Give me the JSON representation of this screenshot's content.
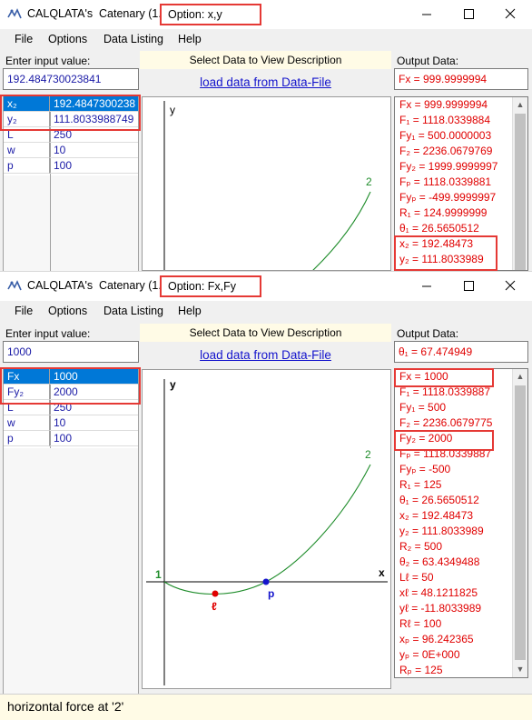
{
  "app_title": "CALQLATA's  Catenary (1.2",
  "menu": [
    "File",
    "Options",
    "Data Listing",
    "Help"
  ],
  "labels": {
    "enter_input": "Enter input value:",
    "select_desc": "Select Data to View Description",
    "load_data": "load data from Data-File",
    "output_data": "Output Data:"
  },
  "window1": {
    "option": "Option: x,y",
    "input_value": "192.484730023841",
    "output_value": "Fx = 999.9999994",
    "grid": [
      {
        "k": "x₂",
        "v": "192.4847300238",
        "selected": true
      },
      {
        "k": "y₂",
        "v": "111.8033988749",
        "selected": false
      },
      {
        "k": "L",
        "v": "250",
        "selected": false
      },
      {
        "k": "w",
        "v": "10",
        "selected": false
      },
      {
        "k": "p",
        "v": "100",
        "selected": false
      }
    ],
    "outputs": [
      "Fx = 999.9999994",
      "F₁ = 1118.0339884",
      "Fy₁ = 500.0000003",
      "F₂ = 2236.0679769",
      "Fy₂ = 1999.9999997",
      "Fₚ = 1118.0339881",
      "Fyₚ = -499.9999997",
      "R₁ = 124.9999999",
      "θ₁ = 26.5650512",
      "x₂ = 192.48473",
      "y₂ = 111.8033989"
    ],
    "plot": {
      "y_axis_label": "y",
      "end_label": "2"
    }
  },
  "window2": {
    "option": "Option: Fx,Fy",
    "input_value": "1000",
    "output_value": "θ₁ = 67.474949",
    "grid": [
      {
        "k": "Fx",
        "v": "1000",
        "selected": true
      },
      {
        "k": "Fy₂",
        "v": "2000",
        "selected": false
      },
      {
        "k": "L",
        "v": "250",
        "selected": false
      },
      {
        "k": "w",
        "v": "10",
        "selected": false
      },
      {
        "k": "p",
        "v": "100",
        "selected": false
      }
    ],
    "outputs": [
      "Fx = 1000",
      "F₁ = 1118.0339887",
      "Fy₁ = 500",
      "F₂ = 2236.0679775",
      "Fy₂ = 2000",
      "Fₚ = 1118.0339887",
      "Fyₚ = -500",
      "R₁ = 125",
      "θ₁ = 26.5650512",
      "x₂ = 192.48473",
      "y₂ = 111.8033989",
      "R₂ = 500",
      "θ₂ = 63.4349488",
      "Lℓ = 50",
      "xℓ = 48.1211825",
      "yℓ = -11.8033989",
      "Rℓ = 100",
      "xₚ = 96.242365",
      "yₚ = 0E+000",
      "Rₚ = 125"
    ],
    "plot": {
      "y_axis_label": "y",
      "x_axis_label": "x",
      "start_label": "1",
      "end_label": "2",
      "low_point_label": "ℓ",
      "p_label": "p"
    }
  },
  "status": "horizontal force at '2'",
  "colors": {
    "highlight": "#e53935",
    "selection": "#0078d7",
    "output_text": "#e00000",
    "input_text": "#1a1aa6",
    "curve": "#1e8c2a"
  }
}
